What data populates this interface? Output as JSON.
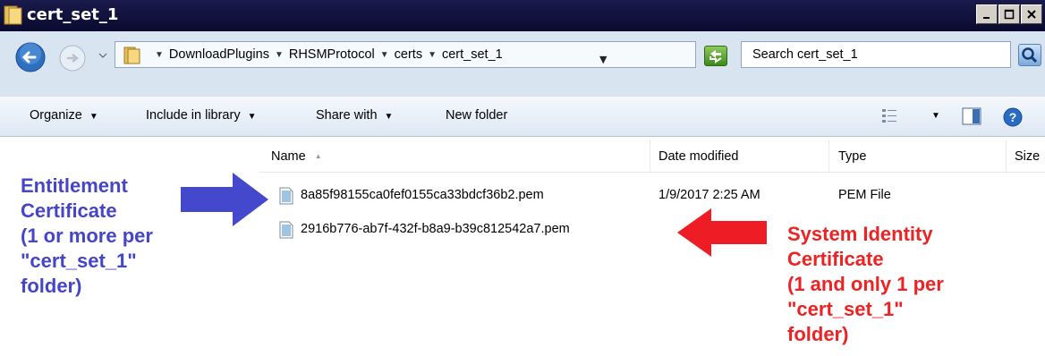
{
  "window": {
    "title": "cert_set_1"
  },
  "address": {
    "breadcrumb": [
      "DownloadPlugins",
      "RHSMProtocol",
      "certs",
      "cert_set_1"
    ],
    "search_placeholder": "Search cert_set_1"
  },
  "toolbar": {
    "organize": "Organize",
    "include_in_library": "Include in library",
    "share_with": "Share with",
    "new_folder": "New folder"
  },
  "columns": {
    "name": "Name",
    "date_modified": "Date modified",
    "type": "Type",
    "size": "Size"
  },
  "files": [
    {
      "name": "8a85f98155ca0fef0155ca33bdcf36b2.pem",
      "date_modified": "1/9/2017 2:25 AM",
      "type": "PEM File"
    },
    {
      "name": "2916b776-ab7f-432f-b8a9-b39c812542a7.pem",
      "date_modified": "",
      "type": ""
    }
  ],
  "annotations": {
    "entitlement": [
      "Entitlement",
      "Certificate",
      "(1 or more per",
      "\"cert_set_1\"",
      "folder)"
    ],
    "identity": [
      "System Identity",
      "Certificate",
      "(1 and only 1 per",
      "\"cert_set_1\"",
      "folder)"
    ]
  },
  "colors": {
    "blue_annotation": "#4545c8",
    "red_annotation": "#ee2222",
    "titlebar": "#0a0a30"
  },
  "icons": [
    "folder-icon",
    "back-arrow-icon",
    "forward-arrow-icon",
    "refresh-icon",
    "search-icon",
    "view-options-icon",
    "preview-pane-icon",
    "help-icon",
    "pem-file-icon",
    "blue-arrow-icon",
    "red-arrow-icon"
  ]
}
